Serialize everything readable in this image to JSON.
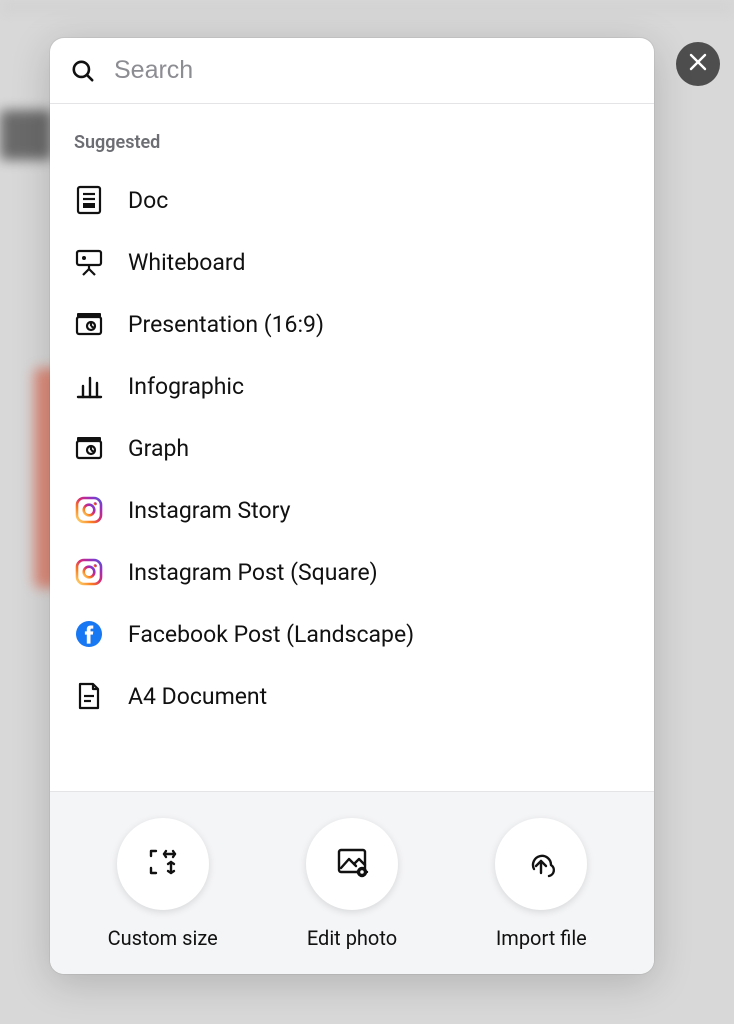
{
  "search": {
    "placeholder": "Search",
    "value": ""
  },
  "section_label": "Suggested",
  "items": [
    {
      "label": "Doc",
      "icon": "doc-icon"
    },
    {
      "label": "Whiteboard",
      "icon": "whiteboard-icon"
    },
    {
      "label": "Presentation (16:9)",
      "icon": "presentation-icon"
    },
    {
      "label": "Infographic",
      "icon": "chart-icon"
    },
    {
      "label": "Graph",
      "icon": "presentation-icon"
    },
    {
      "label": "Instagram Story",
      "icon": "instagram-icon"
    },
    {
      "label": "Instagram Post (Square)",
      "icon": "instagram-icon"
    },
    {
      "label": "Facebook Post (Landscape)",
      "icon": "facebook-icon"
    },
    {
      "label": "A4 Document",
      "icon": "a4-icon"
    }
  ],
  "actions": [
    {
      "label": "Custom size",
      "icon": "custom-size-icon"
    },
    {
      "label": "Edit photo",
      "icon": "edit-photo-icon"
    },
    {
      "label": "Import file",
      "icon": "import-file-icon"
    }
  ]
}
